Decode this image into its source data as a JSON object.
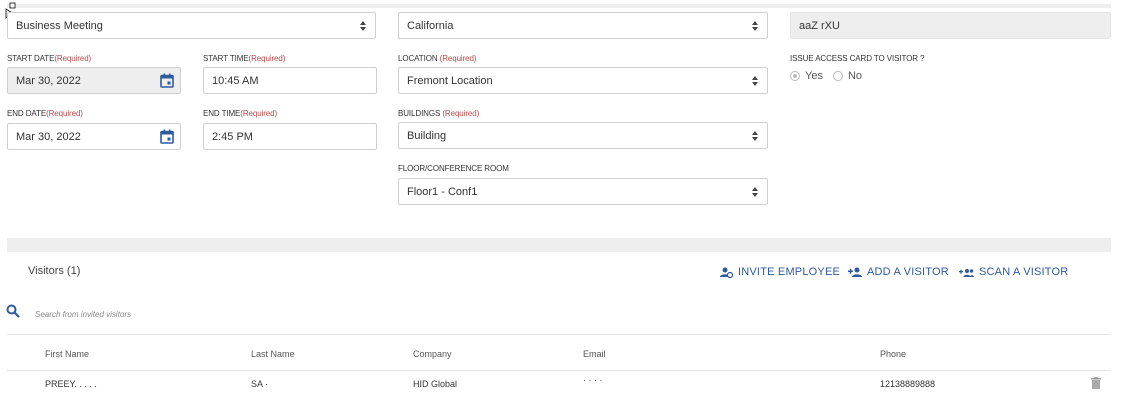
{
  "form": {
    "purpose": "Business Meeting",
    "state": "California",
    "host": "aaZ rXU",
    "start_date_label": "START DATE",
    "start_date": "Mar 30, 2022",
    "start_time_label": "START TIME",
    "start_time": "10:45 AM",
    "location_label": "LOCATION ",
    "location": "Fremont Location",
    "issue_card_label": "ISSUE ACCESS CARD TO VISITOR ?",
    "yes_label": "Yes",
    "no_label": "No",
    "end_date_label": "END DATE",
    "end_date": "Mar 30, 2022",
    "end_time_label": "END TIME",
    "end_time": "2:45 PM",
    "buildings_label": "BUILDINGS ",
    "building": "Building",
    "floor_label": "FLOOR/CONFERENCE ROOM",
    "floor": "Floor1 - Conf1",
    "required": "(Required)"
  },
  "visitors": {
    "title": "Visitors (1)",
    "invite_employee": "INVITE EMPLOYEE",
    "add_visitor": "ADD A VISITOR",
    "scan_visitor": "SCAN A VISITOR",
    "search_placeholder": "Search from invited visitors",
    "columns": [
      "First Name",
      "Last Name",
      "Company",
      "Email",
      "Phone"
    ],
    "rows": [
      {
        "first_name": "PREEY. . . . .",
        "last_name": "SA  ·",
        "company": "HID Global",
        "email": "·   ·  ·  ·",
        "phone": "12138889888"
      }
    ]
  },
  "colors": {
    "accent": "#2f5a9e",
    "required": "#b84a4a",
    "disabled_bg": "#eeeeee"
  }
}
